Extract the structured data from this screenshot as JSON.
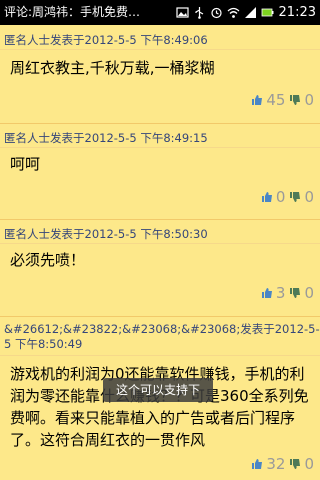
{
  "statusbar": {
    "title": "评论:周鸿祎：手机免费…",
    "time": "21:23"
  },
  "comments": [
    {
      "header": "匿名人士发表于2012-5-5 下午8:49:06",
      "content": "周红衣教主,千秋万载,一桶浆糊",
      "up": "45",
      "down": "0"
    },
    {
      "header": "匿名人士发表于2012-5-5 下午8:49:15",
      "content": "呵呵",
      "up": "0",
      "down": "0"
    },
    {
      "header": "匿名人士发表于2012-5-5 下午8:50:30",
      "content": "必须先喷！",
      "up": "3",
      "down": "0"
    },
    {
      "header": "&#26612;&#23822;&#23068;&#23068;发表于2012-5-5 下午8:50:49",
      "content": "游戏机的利润为0还能靠软件赚钱，手机的利润为零还能靠什么赚钱？？可是360全系列免费啊。看来只能靠植入的广告或者后门程序了。这符合周红衣的一贯作风",
      "up": "32",
      "down": "0"
    }
  ],
  "toast": "这个可以支持下",
  "colors": {
    "background": "#fde88a",
    "header_text": "#35467a",
    "vote_text": "#9a9a9a",
    "up_icon": "#4a86c6",
    "down_icon": "#4e7a57"
  }
}
